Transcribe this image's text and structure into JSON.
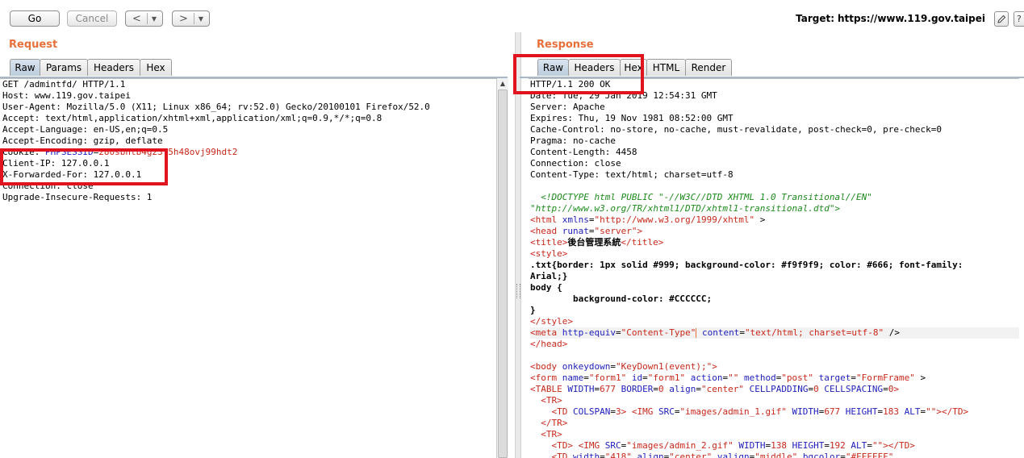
{
  "toolbar": {
    "go_label": "Go",
    "cancel_label": "Cancel",
    "back_arrow": "<",
    "forward_arrow": ">",
    "dropdown_caret": "▼",
    "target_label": "Target:",
    "target_url": "https://www.119.gov.taipei",
    "edit_icon": "pencil-icon",
    "help_icon": "help-icon"
  },
  "request": {
    "title": "Request",
    "tabs": [
      "Raw",
      "Params",
      "Headers",
      "Hex"
    ],
    "active_tab": "Raw",
    "lines": [
      "GET /admintfd/ HTTP/1.1",
      "Host: www.119.gov.taipei",
      "User-Agent: Mozilla/5.0 (X11; Linux x86_64; rv:52.0) Gecko/20100101 Firefox/52.0",
      "Accept: text/html,application/xhtml+xml,application/xml;q=0.9,*/*;q=0.8",
      "Accept-Language: en-US,en;q=0.5",
      "Accept-Encoding: gzip, deflate"
    ],
    "cookie_name": "Cookie: ",
    "cookie_key": "PHPSESSID",
    "cookie_eq": "=",
    "cookie_value": "280sbntb4g23l5h48ovj99hdt2",
    "lines_after": [
      "Client-IP: 127.0.0.1",
      "X-Forwarded-For: 127.0.0.1",
      "Connection: close",
      "Upgrade-Insecure-Requests: 1"
    ]
  },
  "response": {
    "title": "Response",
    "tabs": [
      "Raw",
      "Headers",
      "Hex",
      "HTML",
      "Render"
    ],
    "active_tab": "Raw",
    "headers": [
      "HTTP/1.1 200 OK",
      "Date: Tue, 29 Jan 2019 12:54:31 GMT",
      "Server: Apache",
      "Expires: Thu, 19 Nov 1981 08:52:00 GMT",
      "Cache-Control: no-store, no-cache, must-revalidate, post-check=0, pre-check=0",
      "Pragma: no-cache",
      "Content-Length: 4458",
      "Connection: close",
      "Content-Type: text/html; charset=utf-8"
    ],
    "doctype_1": "  <!DOCTYPE html PUBLIC \"-//W3C//DTD XHTML 1.0 Transitional//EN\"",
    "doctype_2": "\"http://www.w3.org/TR/xhtml1/DTD/xhtml1-transitional.dtd\">",
    "html_open": "<html",
    "html_attr": " xmlns",
    "html_eq": "=",
    "html_val": "\"http://www.w3.org/1999/xhtml\"",
    "html_close": " >",
    "head_open": "<head",
    "head_attr": " runat",
    "head_eq": "=",
    "head_val": "\"server\"",
    "head_close": ">",
    "title_open": "<title>",
    "title_text": "後台管理系統",
    "title_close": "</title>",
    "style_open": "<style>",
    "css_1": ".txt{border: 1px solid #999; background-color: #f9f9f9; color: #666; font-family:",
    "css_2": "Arial;}",
    "css_3": "body {",
    "css_4": "        background-color: #CCCCCC;",
    "css_5": "}",
    "style_close": "</style>",
    "meta_open": "<meta",
    "meta_attr1": " http-equiv",
    "meta_eq1": "=",
    "meta_val1": "\"Content-Type\"",
    "meta_attr2": " content",
    "meta_eq2": "=",
    "meta_val2": "\"text/html; charset=utf-8\"",
    "meta_close": " />",
    "head_end": "</head>",
    "body_open": "<body",
    "body_attr": " onkeydown",
    "body_eq": "=",
    "body_val": "\"KeyDown1(event);\"",
    "body_close": ">",
    "form_open": "<form",
    "form_a1": " name",
    "form_v1": "\"form1\"",
    "form_a2": " id",
    "form_v2": "\"form1\"",
    "form_a3": " action",
    "form_v3": "\"\"",
    "form_a4": " method",
    "form_v4": "\"post\"",
    "form_a5": " target",
    "form_v5": "\"FormFrame\"",
    "form_close": " >",
    "table_open": "<TABLE",
    "table_a1": " WIDTH",
    "table_v1": "677",
    "table_a2": " BORDER",
    "table_v2": "0",
    "table_a3": " align",
    "table_v3": "\"center\"",
    "table_a4": " CELLPADDING",
    "table_v4": "0",
    "table_a5": " CELLSPACING",
    "table_v5": "0",
    "table_close": ">",
    "tr_open": "  <TR>",
    "td1_indent": "    ",
    "td1_open": "<TD",
    "td1_a1": " COLSPAN",
    "td1_v1": "3",
    "td1_gt": ">",
    "img1_open": " <IMG",
    "img1_a1": " SRC",
    "img1_v1": "\"images/admin_1.gif\"",
    "img1_a2": " WIDTH",
    "img1_v2": "677",
    "img1_a3": " HEIGHT",
    "img1_v3": "183",
    "img1_a4": " ALT",
    "img1_v4": "\"\"",
    "img1_close": "></TD>",
    "tr_close": "  </TR>",
    "tr2_open": "  <TR>",
    "td2_indent": "    ",
    "td2_open": "<TD>",
    "img2_open": " <IMG",
    "img2_a1": " SRC",
    "img2_v1": "\"images/admin_2.gif\"",
    "img2_a2": " WIDTH",
    "img2_v2": "138",
    "img2_a3": " HEIGHT",
    "img2_v3": "192",
    "img2_a4": " ALT",
    "img2_v4": "\"\"",
    "img2_close": "></TD>",
    "td3_indent": "    ",
    "td3_open": "<TD",
    "td3_a1": " width",
    "td3_v1": "\"418\"",
    "td3_a2": " align",
    "td3_v2": "\"center\"",
    "td3_a3": " valign",
    "td3_v3": "\"middle\"",
    "td3_a4": " bgcolor",
    "td3_v4": "\"#FFFFFF\""
  }
}
